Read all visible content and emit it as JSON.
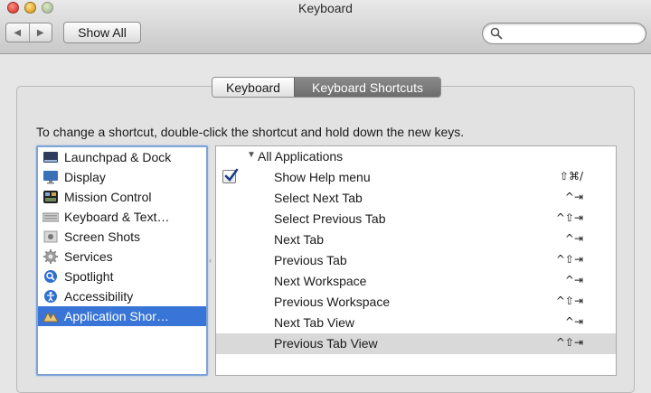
{
  "window": {
    "title": "Keyboard"
  },
  "toolbar": {
    "back_glyph": "◀",
    "forward_glyph": "▶",
    "show_all_label": "Show All",
    "search": {
      "value": "",
      "placeholder": ""
    }
  },
  "tabs": [
    {
      "label": "Keyboard",
      "active": false
    },
    {
      "label": "Keyboard Shortcuts",
      "active": true
    }
  ],
  "instruction": "To change a shortcut, double-click the shortcut and hold down the new keys.",
  "categories": [
    {
      "label": "Launchpad & Dock",
      "icon": "launchpad-dock-icon",
      "selected": false
    },
    {
      "label": "Display",
      "icon": "display-icon",
      "selected": false
    },
    {
      "label": "Mission Control",
      "icon": "mission-control-icon",
      "selected": false
    },
    {
      "label": "Keyboard & Text…",
      "icon": "keyboard-icon",
      "selected": false
    },
    {
      "label": "Screen Shots",
      "icon": "screenshot-icon",
      "selected": false
    },
    {
      "label": "Services",
      "icon": "gear-icon",
      "selected": false
    },
    {
      "label": "Spotlight",
      "icon": "spotlight-icon",
      "selected": false
    },
    {
      "label": "Accessibility",
      "icon": "accessibility-icon",
      "selected": false
    },
    {
      "label": "Application Shor…",
      "icon": "app-shortcuts-icon",
      "selected": true
    }
  ],
  "shortcuts": {
    "group_label": "All Applications",
    "group_glyph": "▼",
    "rows": [
      {
        "name": "Show Help menu",
        "keys": "⇧⌘/",
        "checked": true
      },
      {
        "name": "Select Next Tab",
        "keys": "^⇥",
        "checked": false
      },
      {
        "name": "Select Previous Tab",
        "keys": "^⇧⇥",
        "checked": false
      },
      {
        "name": "Next Tab",
        "keys": "^⇥",
        "checked": false
      },
      {
        "name": "Previous Tab",
        "keys": "^⇧⇥",
        "checked": false
      },
      {
        "name": "Next Workspace",
        "keys": "^⇥",
        "checked": false
      },
      {
        "name": "Previous Workspace",
        "keys": "^⇧⇥",
        "checked": false
      },
      {
        "name": "Next Tab View",
        "keys": "^⇥",
        "checked": false
      },
      {
        "name": "Previous Tab View",
        "keys": "^⇧⇥",
        "checked": false
      }
    ]
  },
  "colors": {
    "selection": "#3875d7",
    "highlight_row": "#d9d9d9",
    "focus_ring": "#7ea3d6"
  }
}
